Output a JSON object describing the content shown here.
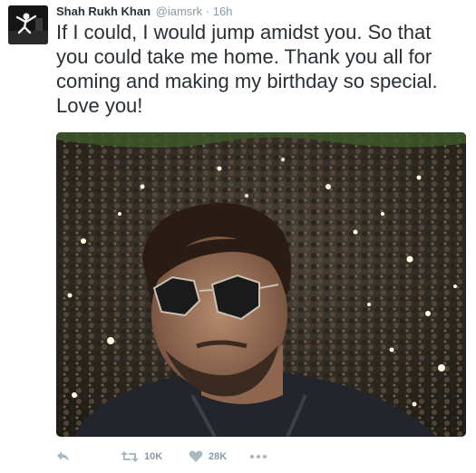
{
  "tweet": {
    "author_name": "Shah Rukh Khan",
    "handle": "@iamsrk",
    "separator": "·",
    "time": "16h",
    "text": "If I could, I would jump amidst you. So that you could take me home. Thank you all for coming and making my birthday so special. Love you!"
  },
  "actions": {
    "retweet_count": "10K",
    "like_count": "28K"
  },
  "colors": {
    "text": "#292f33",
    "muted": "#8899a6",
    "icon": "#aab8c2"
  },
  "icons": {
    "reply": "reply-icon",
    "retweet": "retweet-icon",
    "like": "heart-icon",
    "more": "more-icon"
  }
}
